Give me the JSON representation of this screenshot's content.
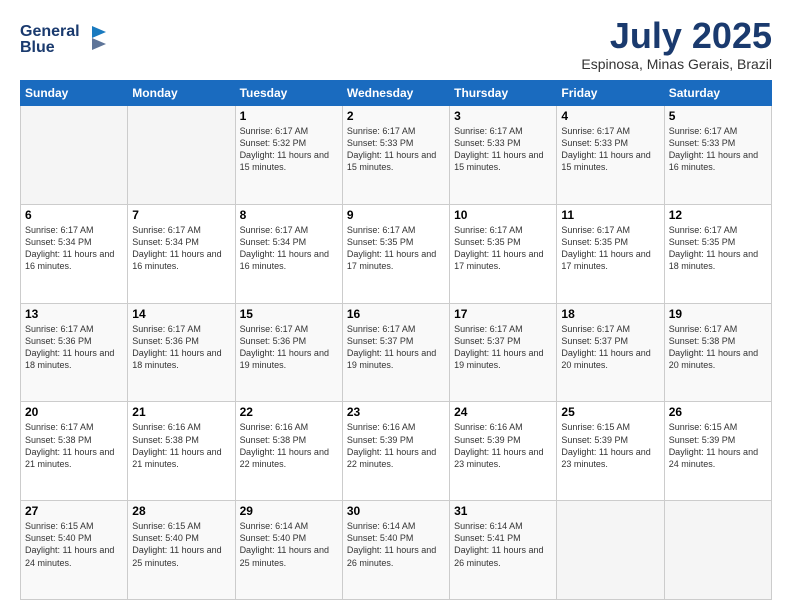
{
  "header": {
    "logo_line1": "General",
    "logo_line2": "Blue",
    "month": "July 2025",
    "location": "Espinosa, Minas Gerais, Brazil"
  },
  "days_of_week": [
    "Sunday",
    "Monday",
    "Tuesday",
    "Wednesday",
    "Thursday",
    "Friday",
    "Saturday"
  ],
  "weeks": [
    [
      {
        "day": "",
        "content": ""
      },
      {
        "day": "",
        "content": ""
      },
      {
        "day": "1",
        "content": "Sunrise: 6:17 AM\nSunset: 5:32 PM\nDaylight: 11 hours and 15 minutes."
      },
      {
        "day": "2",
        "content": "Sunrise: 6:17 AM\nSunset: 5:33 PM\nDaylight: 11 hours and 15 minutes."
      },
      {
        "day": "3",
        "content": "Sunrise: 6:17 AM\nSunset: 5:33 PM\nDaylight: 11 hours and 15 minutes."
      },
      {
        "day": "4",
        "content": "Sunrise: 6:17 AM\nSunset: 5:33 PM\nDaylight: 11 hours and 15 minutes."
      },
      {
        "day": "5",
        "content": "Sunrise: 6:17 AM\nSunset: 5:33 PM\nDaylight: 11 hours and 16 minutes."
      }
    ],
    [
      {
        "day": "6",
        "content": "Sunrise: 6:17 AM\nSunset: 5:34 PM\nDaylight: 11 hours and 16 minutes."
      },
      {
        "day": "7",
        "content": "Sunrise: 6:17 AM\nSunset: 5:34 PM\nDaylight: 11 hours and 16 minutes."
      },
      {
        "day": "8",
        "content": "Sunrise: 6:17 AM\nSunset: 5:34 PM\nDaylight: 11 hours and 16 minutes."
      },
      {
        "day": "9",
        "content": "Sunrise: 6:17 AM\nSunset: 5:35 PM\nDaylight: 11 hours and 17 minutes."
      },
      {
        "day": "10",
        "content": "Sunrise: 6:17 AM\nSunset: 5:35 PM\nDaylight: 11 hours and 17 minutes."
      },
      {
        "day": "11",
        "content": "Sunrise: 6:17 AM\nSunset: 5:35 PM\nDaylight: 11 hours and 17 minutes."
      },
      {
        "day": "12",
        "content": "Sunrise: 6:17 AM\nSunset: 5:35 PM\nDaylight: 11 hours and 18 minutes."
      }
    ],
    [
      {
        "day": "13",
        "content": "Sunrise: 6:17 AM\nSunset: 5:36 PM\nDaylight: 11 hours and 18 minutes."
      },
      {
        "day": "14",
        "content": "Sunrise: 6:17 AM\nSunset: 5:36 PM\nDaylight: 11 hours and 18 minutes."
      },
      {
        "day": "15",
        "content": "Sunrise: 6:17 AM\nSunset: 5:36 PM\nDaylight: 11 hours and 19 minutes."
      },
      {
        "day": "16",
        "content": "Sunrise: 6:17 AM\nSunset: 5:37 PM\nDaylight: 11 hours and 19 minutes."
      },
      {
        "day": "17",
        "content": "Sunrise: 6:17 AM\nSunset: 5:37 PM\nDaylight: 11 hours and 19 minutes."
      },
      {
        "day": "18",
        "content": "Sunrise: 6:17 AM\nSunset: 5:37 PM\nDaylight: 11 hours and 20 minutes."
      },
      {
        "day": "19",
        "content": "Sunrise: 6:17 AM\nSunset: 5:38 PM\nDaylight: 11 hours and 20 minutes."
      }
    ],
    [
      {
        "day": "20",
        "content": "Sunrise: 6:17 AM\nSunset: 5:38 PM\nDaylight: 11 hours and 21 minutes."
      },
      {
        "day": "21",
        "content": "Sunrise: 6:16 AM\nSunset: 5:38 PM\nDaylight: 11 hours and 21 minutes."
      },
      {
        "day": "22",
        "content": "Sunrise: 6:16 AM\nSunset: 5:38 PM\nDaylight: 11 hours and 22 minutes."
      },
      {
        "day": "23",
        "content": "Sunrise: 6:16 AM\nSunset: 5:39 PM\nDaylight: 11 hours and 22 minutes."
      },
      {
        "day": "24",
        "content": "Sunrise: 6:16 AM\nSunset: 5:39 PM\nDaylight: 11 hours and 23 minutes."
      },
      {
        "day": "25",
        "content": "Sunrise: 6:15 AM\nSunset: 5:39 PM\nDaylight: 11 hours and 23 minutes."
      },
      {
        "day": "26",
        "content": "Sunrise: 6:15 AM\nSunset: 5:39 PM\nDaylight: 11 hours and 24 minutes."
      }
    ],
    [
      {
        "day": "27",
        "content": "Sunrise: 6:15 AM\nSunset: 5:40 PM\nDaylight: 11 hours and 24 minutes."
      },
      {
        "day": "28",
        "content": "Sunrise: 6:15 AM\nSunset: 5:40 PM\nDaylight: 11 hours and 25 minutes."
      },
      {
        "day": "29",
        "content": "Sunrise: 6:14 AM\nSunset: 5:40 PM\nDaylight: 11 hours and 25 minutes."
      },
      {
        "day": "30",
        "content": "Sunrise: 6:14 AM\nSunset: 5:40 PM\nDaylight: 11 hours and 26 minutes."
      },
      {
        "day": "31",
        "content": "Sunrise: 6:14 AM\nSunset: 5:41 PM\nDaylight: 11 hours and 26 minutes."
      },
      {
        "day": "",
        "content": ""
      },
      {
        "day": "",
        "content": ""
      }
    ]
  ]
}
